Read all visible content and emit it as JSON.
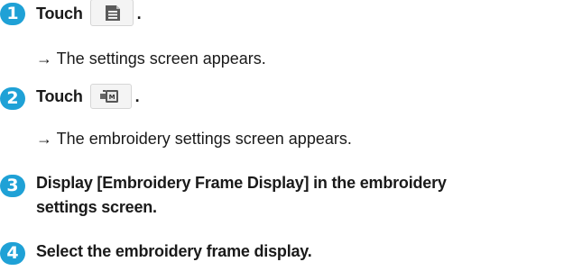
{
  "steps": [
    {
      "number": "1",
      "instruction_before_icon": "Touch",
      "icon": "settings-document-icon",
      "instruction_after_icon": ".",
      "result": "→ The settings screen appears."
    },
    {
      "number": "2",
      "instruction_before_icon": "Touch",
      "icon": "embroidery-settings-icon",
      "instruction_after_icon": ".",
      "result": "→ The embroidery settings screen appears."
    },
    {
      "number": "3",
      "instruction_line1": "Display [Embroidery Frame Display] in the embroidery",
      "instruction_line2": "settings screen."
    },
    {
      "number": "4",
      "instruction_line1": "Select the embroidery frame display."
    }
  ],
  "colors": {
    "badge": "#1fa1d6",
    "text": "#1a1a1a",
    "button_bg": "#f4f4f4"
  }
}
